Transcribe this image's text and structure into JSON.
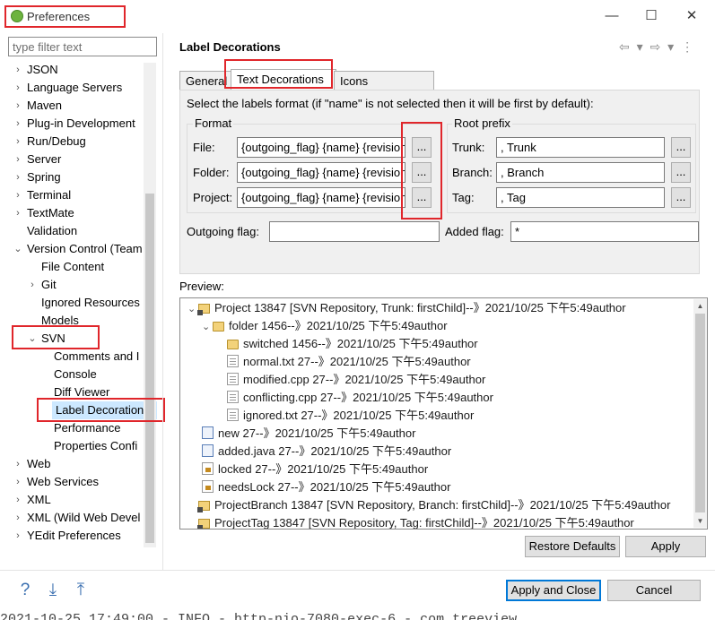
{
  "window": {
    "title": "Preferences",
    "minimize": "—",
    "maximize": "☐",
    "close": "✕"
  },
  "filter": {
    "placeholder": "type filter text"
  },
  "tree": [
    {
      "label": "JSON",
      "level": 0,
      "twisty": "›"
    },
    {
      "label": "Language Servers",
      "level": 0,
      "twisty": "›"
    },
    {
      "label": "Maven",
      "level": 0,
      "twisty": "›"
    },
    {
      "label": "Plug-in Development",
      "level": 0,
      "twisty": "›"
    },
    {
      "label": "Run/Debug",
      "level": 0,
      "twisty": "›"
    },
    {
      "label": "Server",
      "level": 0,
      "twisty": "›"
    },
    {
      "label": "Spring",
      "level": 0,
      "twisty": "›"
    },
    {
      "label": "Terminal",
      "level": 0,
      "twisty": "›"
    },
    {
      "label": "TextMate",
      "level": 0,
      "twisty": "›"
    },
    {
      "label": "Validation",
      "level": 0,
      "twisty": ""
    },
    {
      "label": "Version Control (Team",
      "level": 0,
      "twisty": "⌄"
    },
    {
      "label": "File Content",
      "level": 1,
      "twisty": ""
    },
    {
      "label": "Git",
      "level": 1,
      "twisty": "›"
    },
    {
      "label": "Ignored Resources",
      "level": 1,
      "twisty": ""
    },
    {
      "label": "Models",
      "level": 1,
      "twisty": ""
    },
    {
      "label": "SVN",
      "level": 1,
      "twisty": "⌄"
    },
    {
      "label": "Comments and I",
      "level": 2,
      "twisty": ""
    },
    {
      "label": "Console",
      "level": 2,
      "twisty": ""
    },
    {
      "label": "Diff Viewer",
      "level": 2,
      "twisty": ""
    },
    {
      "label": "Label Decoration",
      "level": 2,
      "twisty": "",
      "selected": true
    },
    {
      "label": "Performance",
      "level": 2,
      "twisty": ""
    },
    {
      "label": "Properties Confi",
      "level": 2,
      "twisty": ""
    },
    {
      "label": "Web",
      "level": 0,
      "twisty": "›"
    },
    {
      "label": "Web Services",
      "level": 0,
      "twisty": "›"
    },
    {
      "label": "XML",
      "level": 0,
      "twisty": "›"
    },
    {
      "label": "XML (Wild Web Devel",
      "level": 0,
      "twisty": "›"
    },
    {
      "label": "YEdit Preferences",
      "level": 0,
      "twisty": "›"
    }
  ],
  "page": {
    "title": "Label Decorations",
    "nav": "⇦ ▾ ⇨ ▾ ⋮"
  },
  "tabs": {
    "general": "General",
    "text": "Text Decorations",
    "icons": "Icons Decorations"
  },
  "form": {
    "intro": "Select the labels format (if \"name\" is not selected then it will be first by default):",
    "format_title": "Format",
    "root_title": "Root prefix",
    "file_label": "File:",
    "folder_label": "Folder:",
    "project_label": "Project:",
    "file_value": "{outgoing_flag} {name} {revision}",
    "folder_value": "{outgoing_flag} {name} {revision}",
    "project_value": "{outgoing_flag} {name} {revision}",
    "dots": "...",
    "trunk_label": "Trunk:",
    "branch_label": "Branch:",
    "tag_label": "Tag:",
    "trunk_value": ", Trunk",
    "branch_value": ", Branch",
    "tag_value": ", Tag",
    "outgoing_label": "Outgoing flag:",
    "outgoing_value": "",
    "added_label": "Added flag:",
    "added_value": "*"
  },
  "preview": {
    "label": "Preview:",
    "items": [
      {
        "text": "Project 13847 [SVN Repository, Trunk: firstChild]--》2021/10/25 下午5:49author",
        "icon": "proj",
        "indent": 0,
        "twisty": "⌄"
      },
      {
        "text": "folder 1456--》2021/10/25 下午5:49author",
        "icon": "fold open",
        "indent": 1,
        "twisty": "⌄"
      },
      {
        "text": "switched 1456--》2021/10/25 下午5:49author",
        "icon": "fold open",
        "indent": 2,
        "twisty": ""
      },
      {
        "text": "normal.txt 27--》2021/10/25 下午5:49author",
        "icon": "doc",
        "indent": 2,
        "twisty": ""
      },
      {
        "text": "modified.cpp 27--》2021/10/25 下午5:49author",
        "icon": "doc",
        "indent": 2,
        "twisty": ""
      },
      {
        "text": "conflicting.cpp 27--》2021/10/25 下午5:49author",
        "icon": "doc",
        "indent": 2,
        "twisty": ""
      },
      {
        "text": "ignored.txt 27--》2021/10/25 下午5:49author",
        "icon": "doc",
        "indent": 2,
        "twisty": ""
      },
      {
        "text": "new 27--》2021/10/25 下午5:49author",
        "icon": "new",
        "indent": 1,
        "twisty": ""
      },
      {
        "text": "added.java 27--》2021/10/25 下午5:49author",
        "icon": "new",
        "indent": 1,
        "twisty": ""
      },
      {
        "text": "locked 27--》2021/10/25 下午5:49author",
        "icon": "lock",
        "indent": 1,
        "twisty": ""
      },
      {
        "text": "needsLock 27--》2021/10/25 下午5:49author",
        "icon": "lock",
        "indent": 1,
        "twisty": ""
      },
      {
        "text": "ProjectBranch 13847 [SVN Repository, Branch: firstChild]--》2021/10/25 下午5:49author",
        "icon": "proj",
        "indent": 0,
        "twisty": ""
      },
      {
        "text": "ProjectTag 13847 [SVN Repository, Tag: firstChild]--》2021/10/25 下午5:49author",
        "icon": "proj",
        "indent": 0,
        "twisty": ""
      }
    ]
  },
  "buttons": {
    "restore": "Restore Defaults",
    "apply": "Apply",
    "apply_close": "Apply and Close",
    "cancel": "Cancel"
  },
  "bottom_icons": {
    "help": "?",
    "import": "⤓",
    "export": "⤒"
  },
  "background_text": "2021-10-25 17:49:00 - INFO - http-nio-7080-exec-6 - com.treeview"
}
